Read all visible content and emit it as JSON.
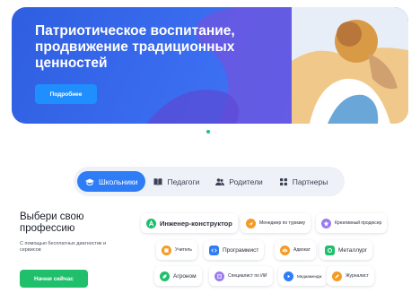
{
  "hero": {
    "title": "Патриотическое воспитание, продвижение традиционных ценностей",
    "button": "Подробнее"
  },
  "tabs": [
    {
      "label": "Школьники",
      "icon": "graduation-cap-icon",
      "active": true
    },
    {
      "label": "Педагоги",
      "icon": "book-icon",
      "active": false
    },
    {
      "label": "Родители",
      "icon": "users-icon",
      "active": false
    },
    {
      "label": "Партнеры",
      "icon": "grid-icon",
      "active": false
    }
  ],
  "left": {
    "title": "Выбери свою профессию",
    "subtitle": "С помощью бесплатных диагностик и сервисов",
    "button": "Начни сейчас"
  },
  "professions": [
    {
      "label": "Инженер-конструктор",
      "icon": "letter-a-icon",
      "color": "#1fbf6c"
    },
    {
      "label": "Менеджер по туризму",
      "icon": "plane-icon",
      "color": "#f59a23"
    },
    {
      "label": "Креативный продюсер",
      "icon": "star-icon",
      "color": "#9a7cf0"
    },
    {
      "label": "Учитель",
      "icon": "book-icon",
      "color": "#f59a23"
    },
    {
      "label": "Программист",
      "icon": "code-icon",
      "color": "#2f7df6"
    },
    {
      "label": "Адвокат",
      "icon": "scales-icon",
      "color": "#f59a23"
    },
    {
      "label": "Металлург",
      "icon": "gear-icon",
      "color": "#1fbf6c"
    },
    {
      "label": "Агроном",
      "icon": "leaf-icon",
      "color": "#1fbf6c"
    },
    {
      "label": "Специалист по ИИ",
      "icon": "chip-icon",
      "color": "#9a7cf0"
    },
    {
      "label": "Медиамендж",
      "icon": "media-icon",
      "color": "#2f7df6"
    },
    {
      "label": "Журналист",
      "icon": "pen-icon",
      "color": "#f59a23"
    }
  ]
}
